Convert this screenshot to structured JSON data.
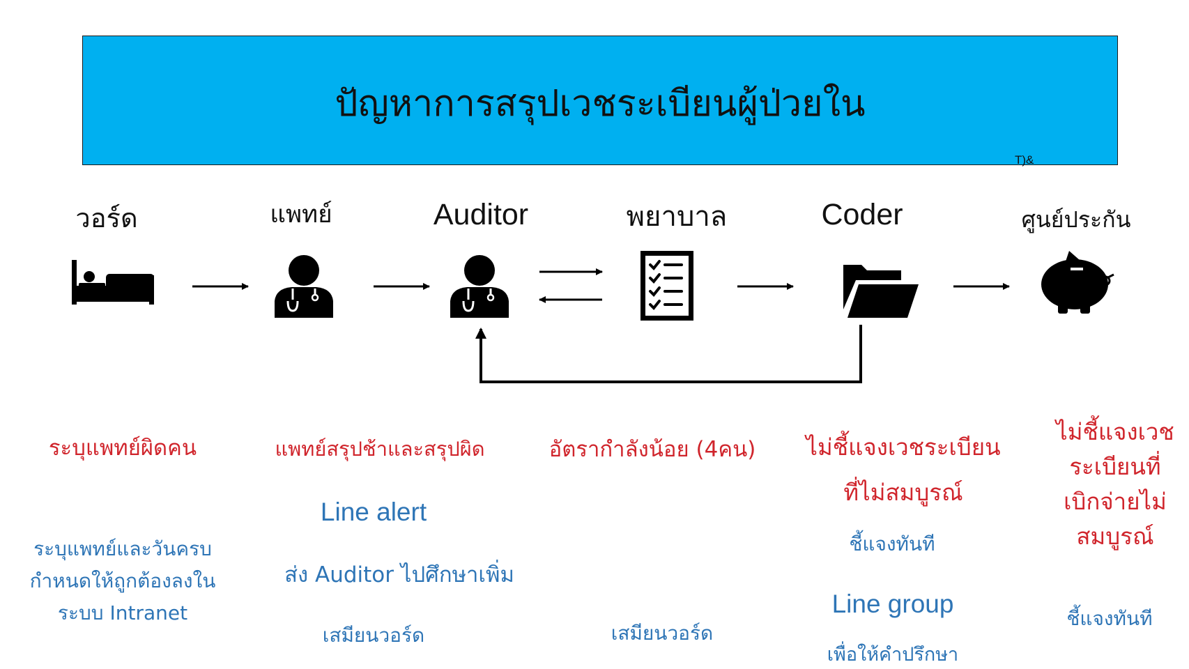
{
  "title": "ปัญหาการสรุปเวชระเบียนผู้ป่วยใน",
  "stray_text": "T)&",
  "stages": [
    {
      "label": "วอร์ด",
      "icon": "bed-icon"
    },
    {
      "label": "แพทย์",
      "icon": "doctor-icon"
    },
    {
      "label": "Auditor",
      "icon": "doctor-icon"
    },
    {
      "label": "พยาบาล",
      "icon": "checklist-icon"
    },
    {
      "label": "Coder",
      "icon": "folder-icon"
    },
    {
      "label": "ศูนย์ประกัน",
      "icon": "piggy-bank-icon"
    }
  ],
  "problems": [
    "ระบุแพทย์ผิดคน",
    "แพทย์สรุปช้าและสรุปผิด",
    "อัตรากำลังน้อย (4คน)",
    "ไม่ชี้แจงเวชระเบียน",
    "ที่ไม่สมบูรณ์",
    "ไม่ชี้แจงเวช",
    "ระเบียนที่",
    "เบิกจ่ายไม่",
    "สมบูรณ์"
  ],
  "solutions": {
    "ward": [
      "ระบุแพทย์และวันครบ",
      "กำหนดให้ถูกต้องลงใน",
      "ระบบ Intranet"
    ],
    "doctor_line_alert": "Line alert",
    "doctor_send": "ส่ง Auditor ไปศึกษาเพิ่ม",
    "doctor_ward": "เสมียนวอร์ด",
    "nurse_ward": "เสมียนวอร์ด",
    "coder_explain": "ชี้แจงทันที",
    "coder_line_group": "Line group",
    "coder_advice": "เพื่อให้คำปรึกษา",
    "insurance_explain": "ชี้แจงทันที"
  },
  "colors": {
    "banner": "#00b0f0",
    "problem": "#d0252c",
    "solution": "#2e75b6",
    "ink": "#000000"
  }
}
